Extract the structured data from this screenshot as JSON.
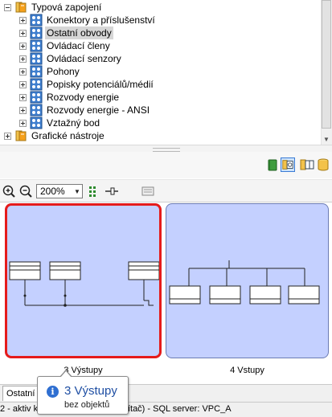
{
  "tree": {
    "items": [
      {
        "label": "Typová zapojení",
        "expanded": true,
        "level": 0,
        "icon": "book-folder-icon"
      },
      {
        "label": "Konektory a příslušenství",
        "expanded": false,
        "level": 1,
        "icon": "component-group-icon"
      },
      {
        "label": "Ostatní obvody",
        "expanded": false,
        "level": 1,
        "icon": "component-group-icon",
        "selected": true
      },
      {
        "label": "Ovládací členy",
        "expanded": false,
        "level": 1,
        "icon": "component-group-icon"
      },
      {
        "label": "Ovládací senzory",
        "expanded": false,
        "level": 1,
        "icon": "component-group-icon"
      },
      {
        "label": "Pohony",
        "expanded": false,
        "level": 1,
        "icon": "component-group-icon"
      },
      {
        "label": "Popisky potenciálů/médií",
        "expanded": false,
        "level": 1,
        "icon": "component-group-icon"
      },
      {
        "label": "Rozvody energie",
        "expanded": false,
        "level": 1,
        "icon": "component-group-icon"
      },
      {
        "label": "Rozvody energie - ANSI",
        "expanded": false,
        "level": 1,
        "icon": "component-group-icon"
      },
      {
        "label": "Vztažný bod",
        "expanded": false,
        "level": 1,
        "icon": "component-group-icon"
      },
      {
        "label": "Grafické nástroje",
        "expanded": false,
        "level": 0,
        "icon": "book-folder-icon"
      }
    ]
  },
  "view_toolbar": {
    "icons": [
      "green-book-icon",
      "macro-view-icon",
      "macro-multi-icon",
      "database-icon"
    ],
    "active": "macro-view-icon"
  },
  "preview_toolbar": {
    "zoom_value": "200%",
    "icons": [
      "zoom-in-icon",
      "zoom-out-icon",
      "grid-icon",
      "pin-icon",
      "preview-icon"
    ]
  },
  "preview": {
    "macros": [
      {
        "label": "3 Výstupy",
        "selected": true
      },
      {
        "label": "4 Vstupy",
        "selected": false
      }
    ]
  },
  "tabs": {
    "active": "Ostatní"
  },
  "status": {
    "text": "2 - aktiv                       kační server: (Tento počítač) - SQL server: VPC_A"
  },
  "tooltip": {
    "title": "3 Výstupy",
    "subtitle": "bez objektů"
  },
  "colors": {
    "selection_red": "#e51b1b",
    "macro_fill": "#c4d0ff",
    "tooltip_title": "#1f4fa3"
  }
}
